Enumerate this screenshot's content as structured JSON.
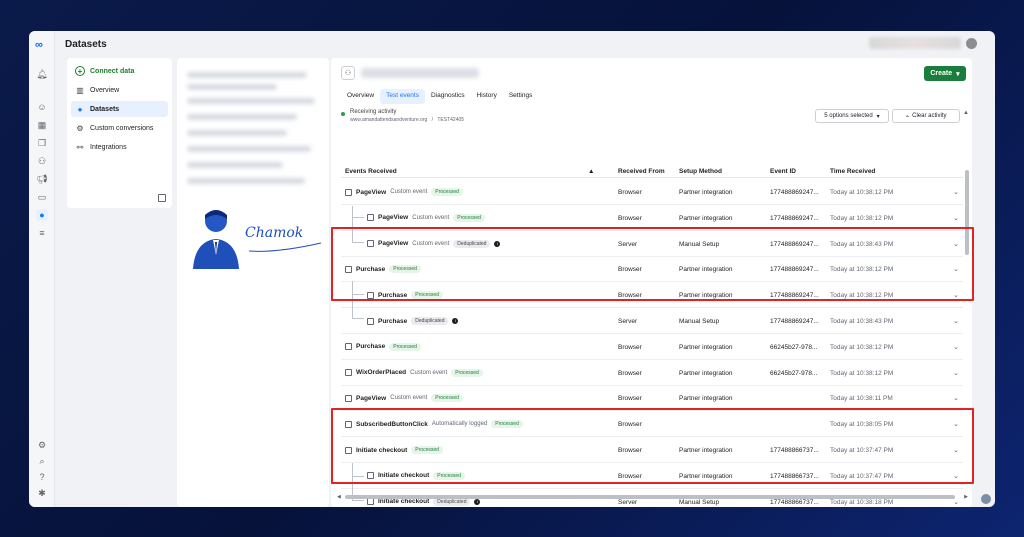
{
  "app": {
    "title": "Datasets"
  },
  "sidenav": {
    "items": [
      {
        "label": "Connect data",
        "icon": "plus-circle-icon"
      },
      {
        "label": "Overview",
        "icon": "overview-icon"
      },
      {
        "label": "Datasets",
        "icon": "datasets-icon",
        "active": true
      },
      {
        "label": "Custom conversions",
        "icon": "gear-icon"
      },
      {
        "label": "Integrations",
        "icon": "integrations-icon"
      }
    ]
  },
  "signature": {
    "text": "Chamok"
  },
  "main": {
    "tabs": [
      {
        "label": "Overview"
      },
      {
        "label": "Test events",
        "active": true
      },
      {
        "label": "Diagnostics"
      },
      {
        "label": "History"
      },
      {
        "label": "Settings"
      }
    ],
    "create_label": "Create",
    "receiving_label": "Receiving activity",
    "receiving_site": "www.amandattendsandventure.org",
    "receiving_sep": "/",
    "receiving_code": "TEST42405",
    "options_label": "5 options selected",
    "clear_label": "Clear activity"
  },
  "table": {
    "headers": {
      "events": "Events Received",
      "from": "Received From",
      "method": "Setup Method",
      "event_id": "Event ID",
      "time": "Time Received"
    },
    "rows": [
      {
        "indent": 0,
        "name": "PageView",
        "sub": "Custom event",
        "badge": "Processed",
        "badge_type": "proc",
        "info": false,
        "from": "Browser",
        "method": "Partner integration",
        "id": "177488869247...",
        "time": "Today at 10:38:12 PM"
      },
      {
        "indent": 1,
        "name": "PageView",
        "sub": "Custom event",
        "badge": "Processed",
        "badge_type": "proc",
        "info": false,
        "from": "Browser",
        "method": "Partner integration",
        "id": "177488869247...",
        "time": "Today at 10:38:12 PM"
      },
      {
        "indent": 1,
        "name": "PageView",
        "sub": "Custom event",
        "badge": "Deduplicated",
        "badge_type": "dedup",
        "info": true,
        "from": "Server",
        "method": "Manual Setup",
        "id": "177488869247...",
        "time": "Today at 10:38:43 PM"
      },
      {
        "indent": 0,
        "name": "Purchase",
        "sub": "",
        "badge": "Processed",
        "badge_type": "proc",
        "info": false,
        "from": "Browser",
        "method": "Partner integration",
        "id": "177488869247...",
        "time": "Today at 10:38:12 PM"
      },
      {
        "indent": 1,
        "name": "Purchase",
        "sub": "",
        "badge": "Processed",
        "badge_type": "proc",
        "info": false,
        "from": "Browser",
        "method": "Partner integration",
        "id": "177488869247...",
        "time": "Today at 10:38:12 PM"
      },
      {
        "indent": 1,
        "name": "Purchase",
        "sub": "",
        "badge": "Deduplicated",
        "badge_type": "dedup",
        "info": true,
        "from": "Server",
        "method": "Manual Setup",
        "id": "177488869247...",
        "time": "Today at 10:38:43 PM"
      },
      {
        "indent": 0,
        "name": "Purchase",
        "sub": "",
        "badge": "Processed",
        "badge_type": "proc",
        "info": false,
        "from": "Browser",
        "method": "Partner integration",
        "id": "66245b27-978...",
        "time": "Today at 10:38:12 PM"
      },
      {
        "indent": 0,
        "name": "WixOrderPlaced",
        "sub": "Custom event",
        "badge": "Processed",
        "badge_type": "proc",
        "info": false,
        "from": "Browser",
        "method": "Partner integration",
        "id": "66245b27-978...",
        "time": "Today at 10:38:12 PM"
      },
      {
        "indent": 0,
        "name": "PageView",
        "sub": "Custom event",
        "badge": "Processed",
        "badge_type": "proc",
        "info": false,
        "from": "Browser",
        "method": "Partner integration",
        "id": "",
        "time": "Today at 10:38:11 PM"
      },
      {
        "indent": 0,
        "name": "SubscribedButtonClick",
        "sub": "Automatically logged",
        "badge": "Processed",
        "badge_type": "proc",
        "info": false,
        "from": "Browser",
        "method": "",
        "id": "",
        "time": "Today at 10:38:05 PM"
      },
      {
        "indent": 0,
        "name": "Initiate checkout",
        "sub": "",
        "badge": "Processed",
        "badge_type": "proc",
        "info": false,
        "from": "Browser",
        "method": "Partner integration",
        "id": "177488866737...",
        "time": "Today at 10:37:47 PM"
      },
      {
        "indent": 1,
        "name": "Initiate checkout",
        "sub": "",
        "badge": "Processed",
        "badge_type": "proc",
        "info": false,
        "from": "Browser",
        "method": "Partner integration",
        "id": "177488866737...",
        "time": "Today at 10:37:47 PM"
      },
      {
        "indent": 1,
        "name": "Initiate checkout",
        "sub": "",
        "badge": "Deduplicated",
        "badge_type": "dedup",
        "info": true,
        "from": "Server",
        "method": "Manual Setup",
        "id": "177488866737...",
        "time": "Today at 10:38:18 PM"
      }
    ]
  },
  "colors": {
    "accent": "#1877f2",
    "create": "#1a7d3b",
    "highlight": "#e32323",
    "processed": "#1e7e34"
  }
}
